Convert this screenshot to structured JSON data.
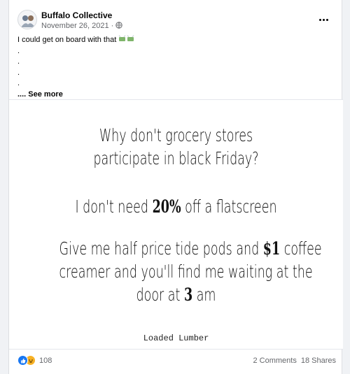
{
  "post": {
    "author": "Buffalo Collective",
    "date": "November 26, 2021 ·",
    "text_lines": [
      "I could get on board with that",
      ".",
      ".",
      ".",
      "."
    ],
    "see_more": ".... See more"
  },
  "image": {
    "line1a": "Why don't grocery stores",
    "line1b": "participate in black Friday?",
    "line2_pre": "I don't need ",
    "line2_num": "20%",
    "line2_post": " off a flatscreen",
    "line3a_pre": "Give me half price tide pods and ",
    "line3a_num": "$1",
    "line3a_post": " coffee",
    "line3b": "creamer and you'll find me waiting at the",
    "line3c_pre": "door at ",
    "line3c_num": "3",
    "line3c_post": " am",
    "watermark": "Loaded Lumber"
  },
  "footer": {
    "reaction_count": "108",
    "comments": "2 Comments",
    "shares": "18 Shares"
  },
  "icons": {
    "reactions": [
      "like-icon",
      "haha-icon"
    ],
    "privacy": "globe-icon",
    "text_emoji": "money-with-wings-icon"
  },
  "colors": {
    "like": "#1877f2",
    "haha": "#f7b125",
    "secondary_text": "#65676b"
  }
}
